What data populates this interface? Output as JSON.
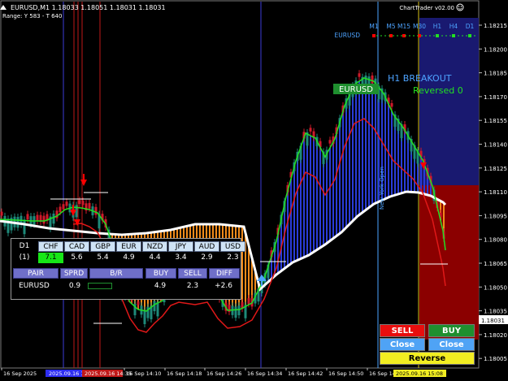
{
  "header": {
    "symbol_line": "EURUSD,M1 1.18033 1.18051 1.18031 1.18031",
    "range_line": "Range: Y 583 - T 640",
    "brand": "ChartTrader v02.00"
  },
  "timeframe_bar": {
    "pair": "EURUSD",
    "timeframes": [
      "M1",
      "M5",
      "M15",
      "M30",
      "H1",
      "H4",
      "D1"
    ]
  },
  "annotations": {
    "breakout": "H1 BREAKOUT",
    "reversed": "Reversed 0",
    "pair_badge": "EURUSD",
    "session_label": "New York Open"
  },
  "price_axis": {
    "labels": [
      "1.18215",
      "1.18200",
      "1.18185",
      "1.18170",
      "1.18155",
      "1.18140",
      "1.18125",
      "1.18110",
      "1.18095",
      "1.18080",
      "1.18065",
      "1.18050",
      "1.18035",
      "1.18020",
      "1.18005"
    ],
    "current": "1.18031"
  },
  "time_axis": {
    "labels": [
      "16 Sep 2025",
      "16 Sep 14:10",
      "16 Sep 14:18",
      "16 Sep 14:26",
      "16 Sep 14:34",
      "16 Sep 14:42",
      "16 Sep 14:50",
      "16 Sep 14:58"
    ],
    "highlight_labels": [
      "2025.09.16 14:0",
      "2025.09.16 14:35",
      "2025.09.16 15:08"
    ]
  },
  "strength_panel": {
    "timeframe": "D1",
    "row_label": "(1)",
    "currencies": [
      "CHF",
      "CAD",
      "GBP",
      "EUR",
      "NZD",
      "JPY",
      "AUD",
      "USD"
    ],
    "values": [
      "7.1",
      "5.6",
      "5.4",
      "4.9",
      "4.4",
      "3.4",
      "2.9",
      "2.3"
    ],
    "columns": [
      "PAIR",
      "SPRD",
      "B/R",
      "BUY",
      "SELL",
      "DIFF"
    ],
    "row": {
      "pair": "EURUSD",
      "spread": "0.9",
      "buy": "4.9",
      "sell": "2.3",
      "diff": "+2.6"
    }
  },
  "buttons": {
    "sell": "SELL",
    "buy": "BUY",
    "close_sell": "Close Sell",
    "close_buy": "Close Buy",
    "reverse": "Reverse"
  },
  "colors": {
    "background": "#000000",
    "bull": "#1e8a7a",
    "bear": "#d01a2a",
    "sell_zone": "#8b0000",
    "buy_zone": "#191970",
    "signal": "#ff0000",
    "ma_green": "#22e022",
    "ma_white": "#ffffff",
    "accent_blue": "#4da3ff"
  }
}
